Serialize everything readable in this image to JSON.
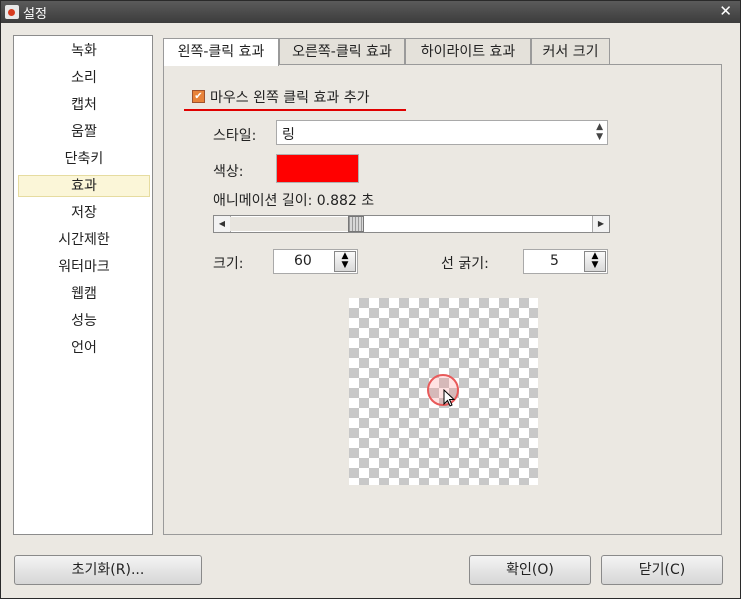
{
  "window": {
    "title": "설정",
    "close_glyph": "✕"
  },
  "sidebar": {
    "items": [
      "녹화",
      "소리",
      "캡처",
      "움짤",
      "단축키",
      "효과",
      "저장",
      "시간제한",
      "워터마크",
      "웹캠",
      "성능",
      "언어"
    ],
    "selected": "효과"
  },
  "tabs": [
    {
      "label": "왼쪽-클릭 효과",
      "active": true
    },
    {
      "label": "오른쪽-클릭 효과",
      "active": false
    },
    {
      "label": "하이라이트 효과",
      "active": false
    },
    {
      "label": "커서 크기",
      "active": false
    }
  ],
  "effect": {
    "enable_label": "마우스 왼쪽 클릭 효과 추가",
    "enabled": true,
    "style_label": "스타일:",
    "style_value": "링",
    "color_label": "색상:",
    "color_value": "#ff0000",
    "duration_label": "애니메이션 길이: 0.882 초",
    "duration_fraction": 0.34,
    "size_label": "크기:",
    "size_value": "60",
    "line_label": "선 굵기:",
    "line_value": "5"
  },
  "buttons": {
    "reset": "초기화(R)...",
    "ok": "확인(O)",
    "close": "닫기(C)"
  },
  "icons": {
    "app": "app-record-icon",
    "checkbox": "checkbox-checked-icon",
    "cursor": "mouse-pointer-icon"
  }
}
